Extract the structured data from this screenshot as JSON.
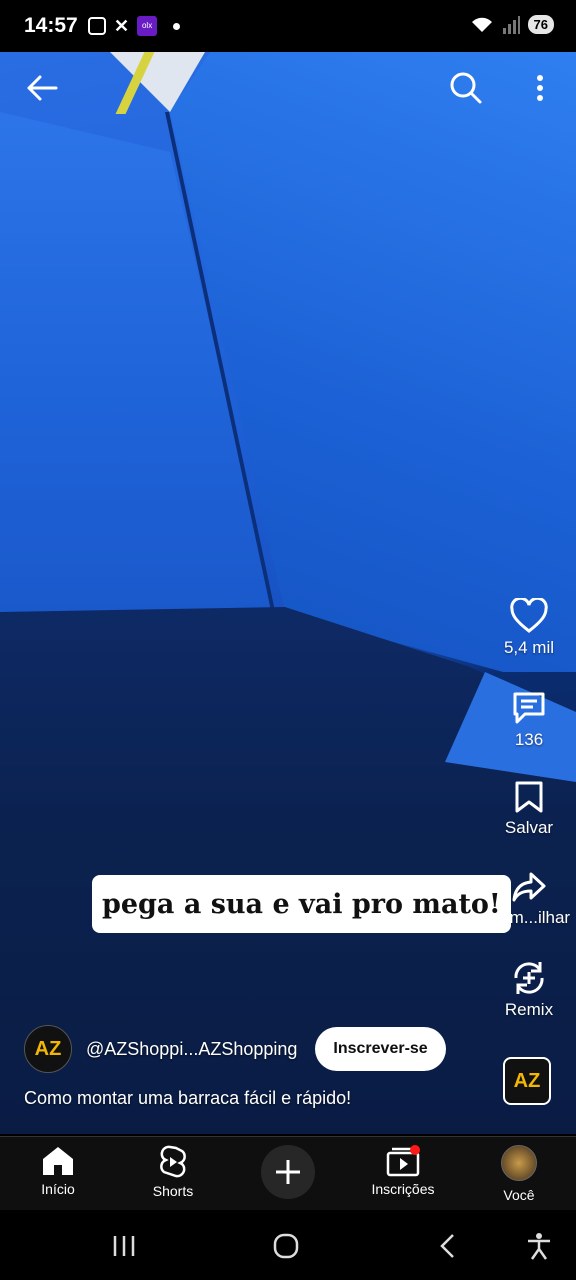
{
  "status_bar": {
    "time": "14:57",
    "battery": "76",
    "icons": [
      "screenshot-icon",
      "x-icon",
      "olx-icon",
      "dot",
      "wifi-icon",
      "signal-icon",
      "battery-icon"
    ],
    "olx_text": "olx"
  },
  "video": {
    "caption_overlay": "pega a sua e vai pro mato!"
  },
  "actions": {
    "like_count": "5,4 mil",
    "comment_count": "136",
    "save_label": "Salvar",
    "share_label": "Com...ilhar",
    "remix_label": "Remix"
  },
  "channel": {
    "avatar_text": "AZ",
    "name": "@AZShoppi...AZShopping",
    "subscribe_label": "Inscrever-se",
    "video_title": "Como montar uma barraca fácil e rápido!",
    "sound_thumb_text": "AZ"
  },
  "bottom_nav": {
    "items": [
      {
        "label": "Início",
        "icon": "home-icon"
      },
      {
        "label": "Shorts",
        "icon": "shorts-icon"
      },
      {
        "label": "",
        "icon": "plus-icon"
      },
      {
        "label": "Inscrições",
        "icon": "subscriptions-icon"
      },
      {
        "label": "Você",
        "icon": "avatar"
      }
    ]
  },
  "colors": {
    "accent_red": "#ff1a1a",
    "tent_blue": "#1f63d8",
    "brand_gold": "#f2b705"
  }
}
